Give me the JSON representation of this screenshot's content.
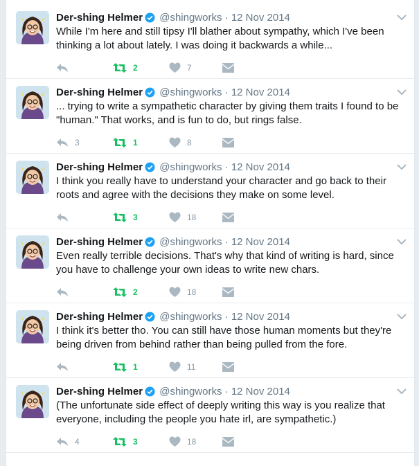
{
  "colors": {
    "background": "#e6ecf0",
    "icon_gray": "#aab8c2",
    "retweet_green": "#17bf63",
    "verified_blue": "#1da1f2",
    "text_dark": "#14171a",
    "text_muted": "#657786"
  },
  "icons": {
    "reply": "reply-icon",
    "retweet": "retweet-icon",
    "like": "heart-icon",
    "dm": "envelope-icon",
    "verified": "verified-badge-icon",
    "caret": "chevron-down-icon"
  },
  "tweets": [
    {
      "name": "Der-shing Helmer",
      "handle": "@shingworks",
      "dot": "·",
      "date": "12 Nov 2014",
      "text": "While I'm here and still tipsy I'll blather about sympathy, which I've been thinking a lot about lately. I was doing it backwards a while...",
      "replies": "",
      "retweets": "2",
      "likes": "7"
    },
    {
      "name": "Der-shing Helmer",
      "handle": "@shingworks",
      "dot": "·",
      "date": "12 Nov 2014",
      "text": "... trying to write a sympathetic character by giving them traits I found to be \"human.\" That works, and is fun to do, but rings false.",
      "replies": "3",
      "retweets": "1",
      "likes": "8"
    },
    {
      "name": "Der-shing Helmer",
      "handle": "@shingworks",
      "dot": "·",
      "date": "12 Nov 2014",
      "text": "I think you really have to understand your character and go back to their roots and agree with the decisions they make on some level.",
      "replies": "",
      "retweets": "3",
      "likes": "18"
    },
    {
      "name": "Der-shing Helmer",
      "handle": "@shingworks",
      "dot": "·",
      "date": "12 Nov 2014",
      "text": "Even really terrible decisions. That's why that kind of writing is hard, since you have to challenge your own ideas to write new chars.",
      "replies": "",
      "retweets": "2",
      "likes": "18"
    },
    {
      "name": "Der-shing Helmer",
      "handle": "@shingworks",
      "dot": "·",
      "date": "12 Nov 2014",
      "text": "I think it's better tho. You can still have those human moments but they're being driven from behind rather than being pulled from the fore.",
      "replies": "",
      "retweets": "1",
      "likes": "11"
    },
    {
      "name": "Der-shing Helmer",
      "handle": "@shingworks",
      "dot": "·",
      "date": "12 Nov 2014",
      "text": "(The unfortunate side effect of deeply writing this way is you realize that everyone, including the people you hate irl, are sympathetic.)",
      "replies": "4",
      "retweets": "3",
      "likes": "18"
    }
  ]
}
